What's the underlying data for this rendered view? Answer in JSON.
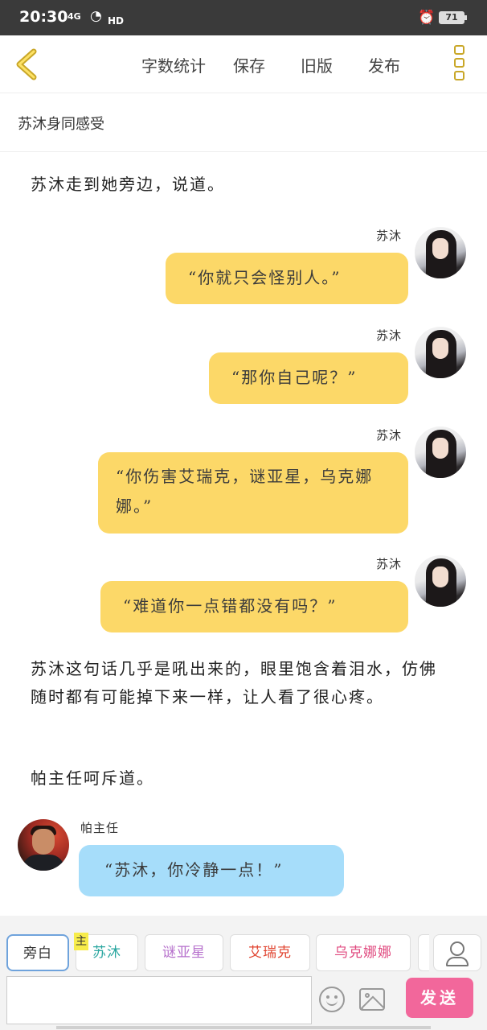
{
  "status_bar": {
    "time": "20:30",
    "network": "4G",
    "hd": "HD",
    "battery": "71"
  },
  "top_bar": {
    "word_count": "字数统计",
    "save": "保存",
    "old_version": "旧版",
    "publish": "发布"
  },
  "chapter_title": "苏沐身同感受",
  "content": {
    "narration_1": "苏沐走到她旁边，说道。",
    "messages": [
      {
        "speaker": "苏沐",
        "text": "“你就只会怪别人。”"
      },
      {
        "speaker": "苏沐",
        "text": "“那你自己呢？”"
      },
      {
        "speaker": "苏沐",
        "text": "“你伤害艾瑞克，谜亚星，乌克娜娜。”"
      },
      {
        "speaker": "苏沐",
        "text": "“难道你一点错都没有吗？”"
      }
    ],
    "narration_2": "苏沐这句话几乎是吼出来的，眼里饱含着泪水，仿佛随时都有可能掉下来一样，让人看了很心疼。",
    "narration_3": "帕主任呵斥道。",
    "left_message": {
      "speaker": "帕主任",
      "text": "“苏沐，你冷静一点！”"
    }
  },
  "roles": {
    "aside": "旁白",
    "main_tag": "主",
    "sumu": "苏沐",
    "miyaxing": "谜亚星",
    "airuike": "艾瑞克",
    "wukenana": "乌克娜娜"
  },
  "input": {
    "placeholder": ""
  },
  "send_label": "发送",
  "colors": {
    "accent_yellow": "#c9a728",
    "bubble_right": "#fcd868",
    "bubble_left": "#a6ddfa",
    "send_button": "#f2679b"
  }
}
